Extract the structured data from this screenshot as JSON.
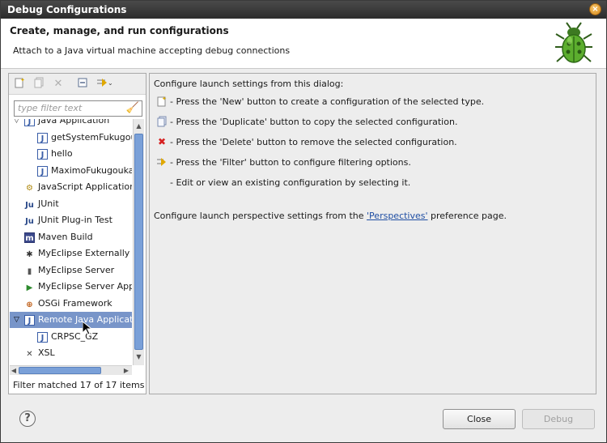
{
  "window": {
    "title": "Debug Configurations",
    "close_label": "×"
  },
  "header": {
    "title": "Create, manage, and run configurations",
    "description": "Attach to a Java virtual machine accepting debug connections"
  },
  "left": {
    "filter_placeholder": "type filter text",
    "tree": [
      {
        "label": "Java Application",
        "level": 0,
        "twisty": "open",
        "icon": "java-app-icon"
      },
      {
        "label": "getSystemFukugou",
        "level": 1,
        "icon": "java-config-icon"
      },
      {
        "label": "hello",
        "level": 1,
        "icon": "java-config-icon"
      },
      {
        "label": "MaximoFukugouka",
        "level": 1,
        "icon": "java-config-icon"
      },
      {
        "label": "JavaScript Application",
        "level": 0,
        "icon": "javascript-icon"
      },
      {
        "label": "JUnit",
        "level": 0,
        "icon": "junit-icon"
      },
      {
        "label": "JUnit Plug-in Test",
        "level": 0,
        "icon": "junit-plugin-icon"
      },
      {
        "label": "Maven Build",
        "level": 0,
        "icon": "maven-icon"
      },
      {
        "label": "MyEclipse Externally l",
        "level": 0,
        "icon": "myeclipse-external-icon"
      },
      {
        "label": "MyEclipse Server",
        "level": 0,
        "icon": "myeclipse-server-icon"
      },
      {
        "label": "MyEclipse Server App",
        "level": 0,
        "icon": "myeclipse-server-app-icon"
      },
      {
        "label": "OSGi Framework",
        "level": 0,
        "icon": "osgi-icon"
      },
      {
        "label": "Remote Java Applicati",
        "level": 0,
        "twisty": "open",
        "icon": "remote-java-icon",
        "selected": true
      },
      {
        "label": "CRPSC_GZ",
        "level": 1,
        "icon": "remote-config-icon"
      },
      {
        "label": "XSL",
        "level": 0,
        "icon": "xsl-icon"
      }
    ],
    "filter_status": "Filter matched 17 of 17 items"
  },
  "right": {
    "intro": "Configure launch settings from this dialog:",
    "lines": [
      {
        "icon": "new-config-icon",
        "text": "- Press the 'New' button to create a configuration of the selected type."
      },
      {
        "icon": "duplicate-icon",
        "text": "- Press the 'Duplicate' button to copy the selected configuration."
      },
      {
        "icon": "delete-icon",
        "text": "- Press the 'Delete' button to remove the selected configuration."
      },
      {
        "icon": "filter-icon",
        "text": "- Press the 'Filter' button to configure filtering options."
      },
      {
        "icon": "",
        "text": "- Edit or view an existing configuration by selecting it."
      }
    ],
    "perspective_prefix": "Configure launch perspective settings from the ",
    "perspective_link": "'Perspectives'",
    "perspective_suffix": " preference page."
  },
  "footer": {
    "help_label": "?",
    "close_label": "Close",
    "debug_label": "Debug"
  }
}
